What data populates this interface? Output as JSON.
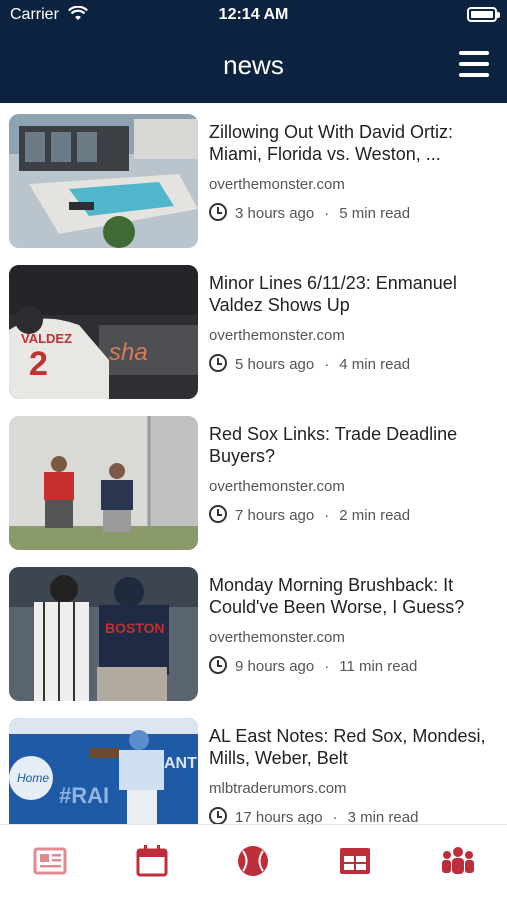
{
  "status_bar": {
    "carrier": "Carrier",
    "time": "12:14 AM"
  },
  "header": {
    "title": "news"
  },
  "articles": [
    {
      "headline": "Zillowing Out With David Ortiz: Miami, Florida vs. Weston, ...",
      "source": "overthemonster.com",
      "time_ago": "3 hours ago",
      "read_time": "5 min read"
    },
    {
      "headline": "Minor Lines 6/11/23: Enmanuel Valdez Shows Up",
      "source": "overthemonster.com",
      "time_ago": "5 hours ago",
      "read_time": "4 min read"
    },
    {
      "headline": "Red Sox Links: Trade Deadline Buyers?",
      "source": "overthemonster.com",
      "time_ago": "7 hours ago",
      "read_time": "2 min read"
    },
    {
      "headline": "Monday Morning Brushback: It Could've Been Worse, I Guess?",
      "source": "overthemonster.com",
      "time_ago": "9 hours ago",
      "read_time": "11 min read"
    },
    {
      "headline": "AL East Notes: Red Sox, Mondesi, Mills, Weber, Belt",
      "source": "mlbtraderumors.com",
      "time_ago": "17 hours ago",
      "read_time": "3 min read"
    }
  ],
  "tabbar": {
    "tabs": [
      {
        "icon": "newspaper-icon",
        "active": true
      },
      {
        "icon": "calendar-icon",
        "active": false
      },
      {
        "icon": "baseball-icon",
        "active": false
      },
      {
        "icon": "table-icon",
        "active": false
      },
      {
        "icon": "team-icon",
        "active": false
      }
    ]
  },
  "colors": {
    "header_bg": "#0c2340",
    "accent": "#bd2d3a",
    "accent_inactive": "#e28a92"
  }
}
